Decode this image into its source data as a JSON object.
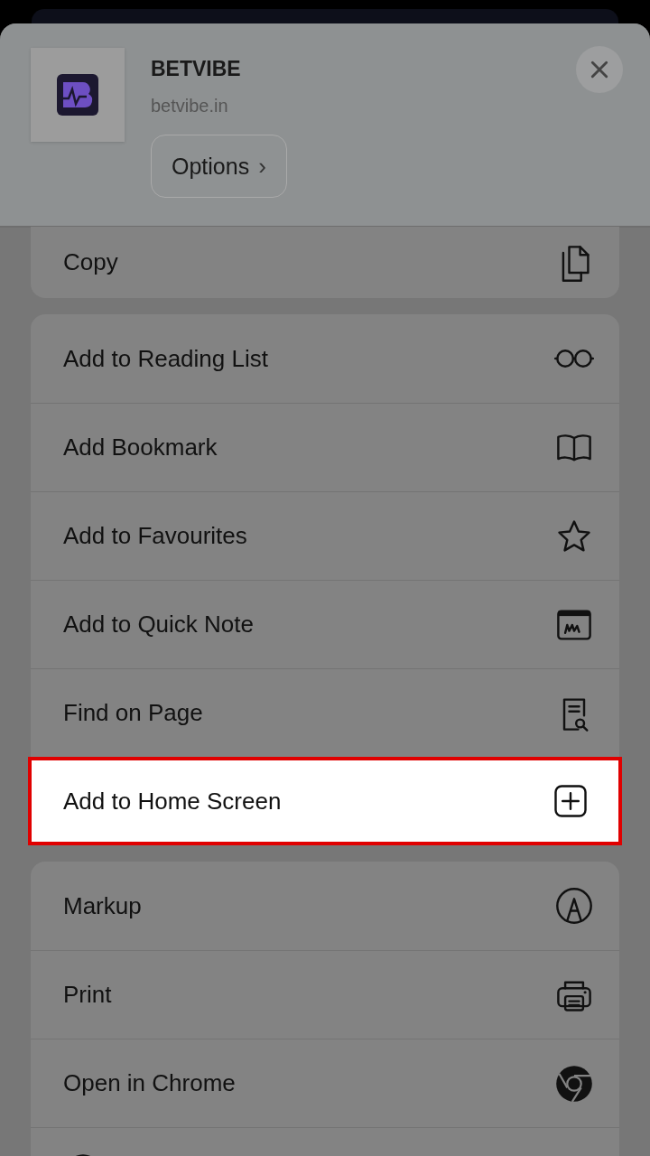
{
  "header": {
    "title": "BETVIBE",
    "url": "betvibe.in",
    "options_button": "Options",
    "options_chevron": "›"
  },
  "groups": [
    {
      "rows": [
        {
          "label": "Copy",
          "kind": "copy",
          "highlighted": false
        }
      ]
    },
    {
      "rows": [
        {
          "label": "Add to Reading List",
          "kind": "glasses",
          "highlighted": false
        },
        {
          "label": "Add Bookmark",
          "kind": "book",
          "highlighted": false
        },
        {
          "label": "Add to Favourites",
          "kind": "star",
          "highlighted": false
        },
        {
          "label": "Add to Quick Note",
          "kind": "note",
          "highlighted": false
        },
        {
          "label": "Find on Page",
          "kind": "find",
          "highlighted": false
        },
        {
          "label": "Add to Home Screen",
          "kind": "plus",
          "highlighted": true
        }
      ]
    },
    {
      "rows": [
        {
          "label": "Markup",
          "kind": "markup",
          "highlighted": false
        },
        {
          "label": "Print",
          "kind": "print",
          "highlighted": false
        },
        {
          "label": "Open in Chrome",
          "kind": "chrome",
          "highlighted": false
        },
        {
          "kind": "disc",
          "highlighted": false
        }
      ]
    }
  ]
}
